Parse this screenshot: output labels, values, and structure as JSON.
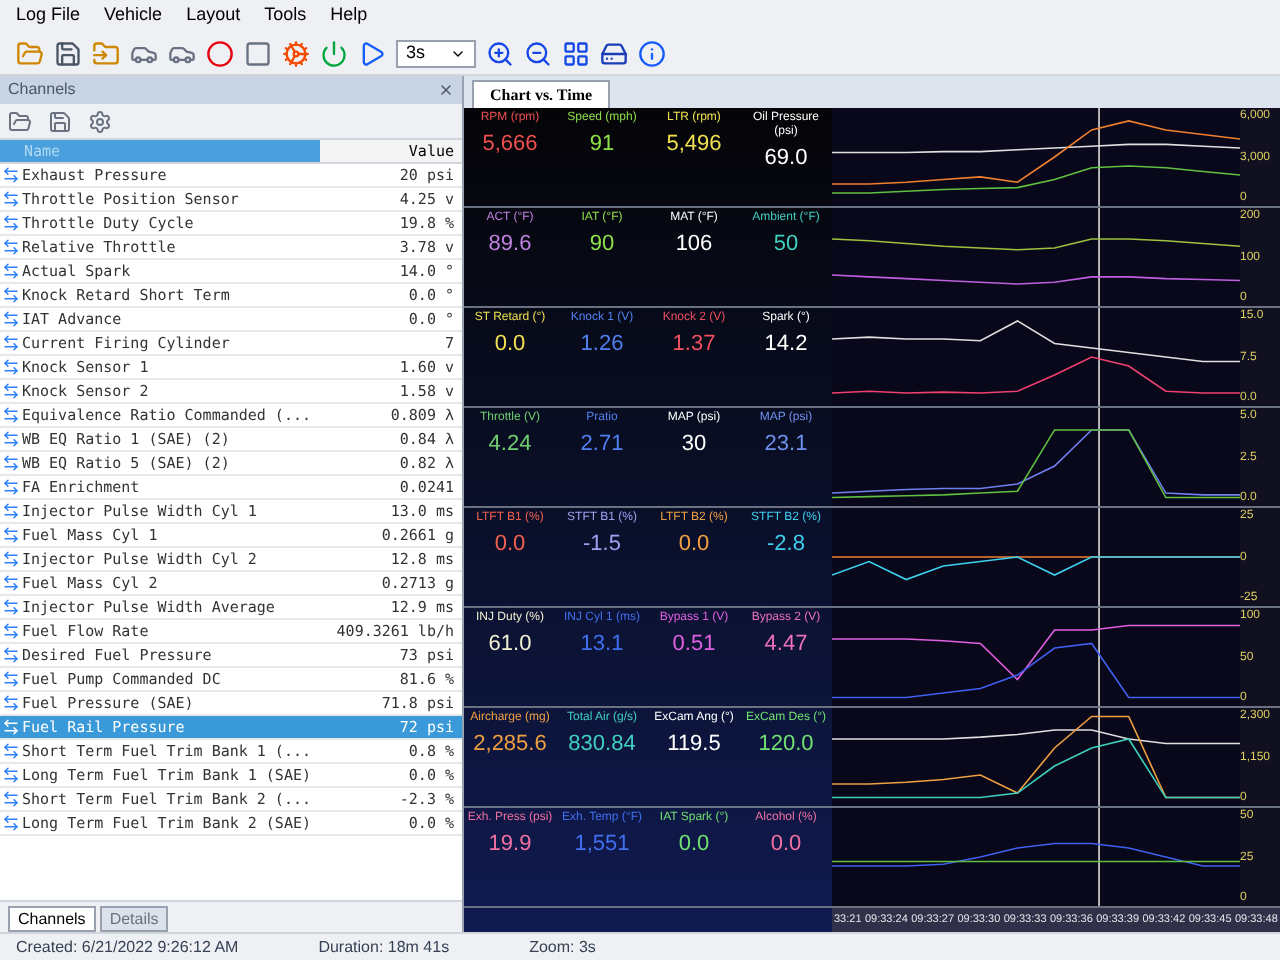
{
  "menu": [
    "Log File",
    "Vehicle",
    "Layout",
    "Tools",
    "Help"
  ],
  "toolbar": {
    "speed": "3s"
  },
  "channels_panel": {
    "title": "Channels",
    "columns": [
      "Name",
      "Value"
    ],
    "rows": [
      {
        "name": "Exhaust Pressure",
        "value": "20 psi",
        "selected": false
      },
      {
        "name": "Throttle Position Sensor",
        "value": "4.25 v",
        "selected": false
      },
      {
        "name": "Throttle Duty Cycle",
        "value": "19.8 %",
        "selected": false
      },
      {
        "name": "Relative Throttle",
        "value": "3.78 v",
        "selected": false
      },
      {
        "name": "Actual Spark",
        "value": "14.0 °",
        "selected": false
      },
      {
        "name": "Knock Retard Short Term",
        "value": "0.0 °",
        "selected": false
      },
      {
        "name": "IAT Advance",
        "value": "0.0 °",
        "selected": false
      },
      {
        "name": "Current Firing Cylinder",
        "value": "7",
        "selected": false
      },
      {
        "name": "Knock Sensor 1",
        "value": "1.60 v",
        "selected": false
      },
      {
        "name": "Knock Sensor 2",
        "value": "1.58 v",
        "selected": false
      },
      {
        "name": "Equivalence Ratio Commanded (...",
        "value": "0.809 λ",
        "selected": false
      },
      {
        "name": "WB EQ Ratio 1 (SAE) (2)",
        "value": "0.84 λ",
        "selected": false
      },
      {
        "name": "WB EQ Ratio 5 (SAE) (2)",
        "value": "0.82 λ",
        "selected": false
      },
      {
        "name": "FA Enrichment",
        "value": "0.0241",
        "selected": false
      },
      {
        "name": "Injector Pulse Width Cyl 1",
        "value": "13.0 ms",
        "selected": false
      },
      {
        "name": "Fuel Mass Cyl 1",
        "value": "0.2661 g",
        "selected": false
      },
      {
        "name": "Injector Pulse Width Cyl 2",
        "value": "12.8 ms",
        "selected": false
      },
      {
        "name": "Fuel Mass Cyl 2",
        "value": "0.2713 g",
        "selected": false
      },
      {
        "name": "Injector Pulse Width Average",
        "value": "12.9 ms",
        "selected": false
      },
      {
        "name": "Fuel Flow Rate",
        "value": "409.3261 lb/h",
        "selected": false
      },
      {
        "name": "Desired Fuel Pressure",
        "value": "73 psi",
        "selected": false
      },
      {
        "name": "Fuel Pump Commanded DC",
        "value": "81.6 %",
        "selected": false
      },
      {
        "name": "Fuel Pressure (SAE)",
        "value": "71.8 psi",
        "selected": false
      },
      {
        "name": "Fuel Rail Pressure",
        "value": "72 psi",
        "selected": true
      },
      {
        "name": "Short Term Fuel Trim Bank 1 (...",
        "value": "0.8 %",
        "selected": false
      },
      {
        "name": "Long Term Fuel Trim Bank 1 (SAE)",
        "value": "0.0 %",
        "selected": false
      },
      {
        "name": "Short Term Fuel Trim Bank 2 (...",
        "value": "-2.3 %",
        "selected": false
      },
      {
        "name": "Long Term Fuel Trim Bank 2 (SAE)",
        "value": "0.0 %",
        "selected": false
      }
    ],
    "tabs": [
      {
        "label": "Channels",
        "selected": true
      },
      {
        "label": "Details",
        "selected": false
      }
    ]
  },
  "chart_tab": {
    "label": "Chart vs. Time",
    "selected": true
  },
  "gauges": [
    {
      "label": "RPM (rpm)",
      "value": "5,666",
      "color": "#f05050"
    },
    {
      "label": "Speed (mph)",
      "value": "91",
      "color": "#8ee04a"
    },
    {
      "label": "LTR (rpm)",
      "value": "5,496",
      "color": "#f0e050"
    },
    {
      "label": "Oil Pressure (psi)",
      "value": "69.0",
      "color": "#ffffff"
    },
    {
      "label": "ACT (°F)",
      "value": "89.6",
      "color": "#c080e0"
    },
    {
      "label": "IAT (°F)",
      "value": "90",
      "color": "#8ee04a"
    },
    {
      "label": "MAT (°F)",
      "value": "106",
      "color": "#ffffff"
    },
    {
      "label": "Ambient (°F)",
      "value": "50",
      "color": "#40d0c0"
    },
    {
      "label": "ST Retard (°)",
      "value": "0.0",
      "color": "#f0e050"
    },
    {
      "label": "Knock 1 (V)",
      "value": "1.26",
      "color": "#5080f0"
    },
    {
      "label": "Knock 2 (V)",
      "value": "1.37",
      "color": "#f05060"
    },
    {
      "label": "Spark (°)",
      "value": "14.2",
      "color": "#ffffff"
    },
    {
      "label": "Throttle (V)",
      "value": "4.24",
      "color": "#70d070"
    },
    {
      "label": "Pratio",
      "value": "2.71",
      "color": "#5080f0"
    },
    {
      "label": "MAP (psi)",
      "value": "30",
      "color": "#ffffff"
    },
    {
      "label": "MAP (psi)",
      "value": "23.1",
      "color": "#7090f0"
    },
    {
      "label": "LTFT B1 (%)",
      "value": "0.0",
      "color": "#f06050"
    },
    {
      "label": "STFT B1 (%)",
      "value": "-1.5",
      "color": "#a0a0f0"
    },
    {
      "label": "LTFT B2 (%)",
      "value": "0.0",
      "color": "#f0a040"
    },
    {
      "label": "STFT B2 (%)",
      "value": "-2.8",
      "color": "#40d0f0"
    },
    {
      "label": "INJ Duty (%)",
      "value": "61.0",
      "color": "#f0f0d0"
    },
    {
      "label": "INJ Cyl 1 (ms)",
      "value": "13.1",
      "color": "#4070f0"
    },
    {
      "label": "Bypass 1 (V)",
      "value": "0.51",
      "color": "#e060e0"
    },
    {
      "label": "Bypass 2 (V)",
      "value": "4.47",
      "color": "#f070c0"
    },
    {
      "label": "Aircharge (mg)",
      "value": "2,285.6",
      "color": "#f0a040"
    },
    {
      "label": "Total Air (g/s)",
      "value": "830.84",
      "color": "#40d0c0"
    },
    {
      "label": "ExCam Ang (°)",
      "value": "119.5",
      "color": "#ffffff"
    },
    {
      "label": "ExCam Des (°)",
      "value": "120.0",
      "color": "#70e070"
    },
    {
      "label": "Exh. Press (psi)",
      "value": "19.9",
      "color": "#f070a0"
    },
    {
      "label": "Exh. Temp (°F)",
      "value": "1,551",
      "color": "#4070f0"
    },
    {
      "label": "IAT Spark (°)",
      "value": "0.0",
      "color": "#70e070"
    },
    {
      "label": "Alcohol (%)",
      "value": "0.0",
      "color": "#f070a0"
    }
  ],
  "strips": [
    {
      "ticks": [
        "6,000",
        "3,000",
        "0"
      ]
    },
    {
      "ticks": [
        "200",
        "100",
        "0"
      ]
    },
    {
      "ticks": [
        "15.0",
        "7.5",
        "0.0"
      ]
    },
    {
      "ticks": [
        "5.0",
        "2.5",
        "0.0"
      ]
    },
    {
      "ticks": [
        "25",
        "0",
        "-25"
      ]
    },
    {
      "ticks": [
        "100",
        "50",
        "0"
      ]
    },
    {
      "ticks": [
        "2,300",
        "1,150",
        "0"
      ]
    },
    {
      "ticks": [
        "50",
        "25",
        "0"
      ]
    }
  ],
  "time_axis": [
    "33:21",
    "09:33:24",
    "09:33:27",
    "09:33:30",
    "09:33:33",
    "09:33:36",
    "09:33:39",
    "09:33:42",
    "09:33:45",
    "09:33:48"
  ],
  "status_bar": [
    "Created: 6/21/2022 9:26:12 AM",
    "Duration: 18m 41s",
    "Zoom: 3s"
  ]
}
